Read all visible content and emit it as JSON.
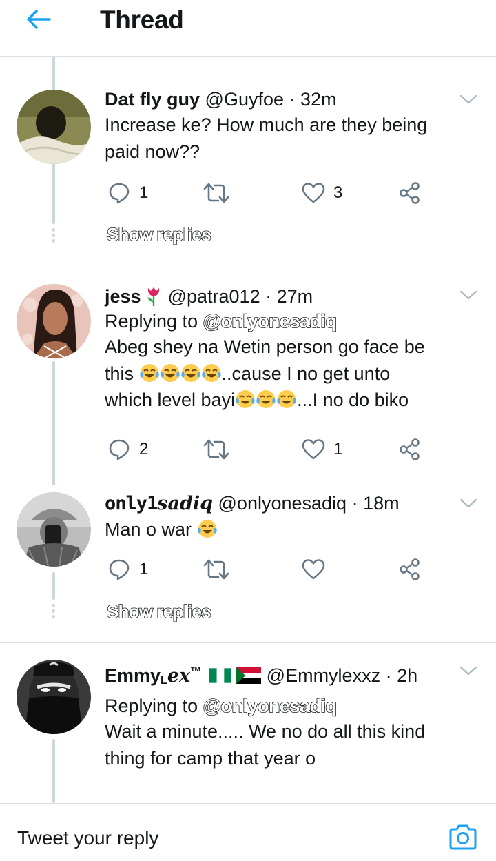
{
  "header": {
    "title": "Thread"
  },
  "tweets": [
    {
      "name": "Dat fly guy",
      "handle": "@Guyfoe",
      "time": "32m",
      "reply_prefix": "",
      "reply_to": "",
      "text_lines": [
        "Increase ke? How much are they being",
        "paid now??"
      ],
      "replies": "1",
      "retweets": "",
      "likes": "3",
      "show_replies": "Show replies"
    },
    {
      "name": "jess",
      "handle": "@patra012",
      "time": "27m",
      "reply_prefix": "Replying to",
      "reply_to": "@onlyonesadiq",
      "text_parts": [
        "Abeg shey na Wetin person go face be",
        "this",
        "..cause I no get unto",
        "which level bayi",
        "...I no do biko"
      ],
      "replies": "2",
      "retweets": "",
      "likes": "1"
    },
    {
      "name_part1": "only1",
      "name_part2": "sadiq",
      "handle": "@onlyonesadiq",
      "time": "18m",
      "text": "Man o war",
      "replies": "1",
      "retweets": "",
      "likes": "",
      "show_replies": "Show replies"
    },
    {
      "name_part1": "Emmy",
      "name_sub": "L",
      "name_part2": "ex",
      "name_tm": "™",
      "handle": "@Emmylexxz",
      "time": "2h",
      "reply_prefix": "Replying to",
      "reply_to": "@onlyonesadiq",
      "text_lines": [
        "Wait a minute..... We no do all this kind",
        "thing for camp that year o"
      ]
    }
  ],
  "separator": "·",
  "compose": {
    "placeholder": "Tweet your reply"
  },
  "colors": {
    "accent": "#1da1f2",
    "icon_gray": "#657786",
    "thread_line": "#ccd6dd",
    "divider": "#dcdfe2"
  }
}
